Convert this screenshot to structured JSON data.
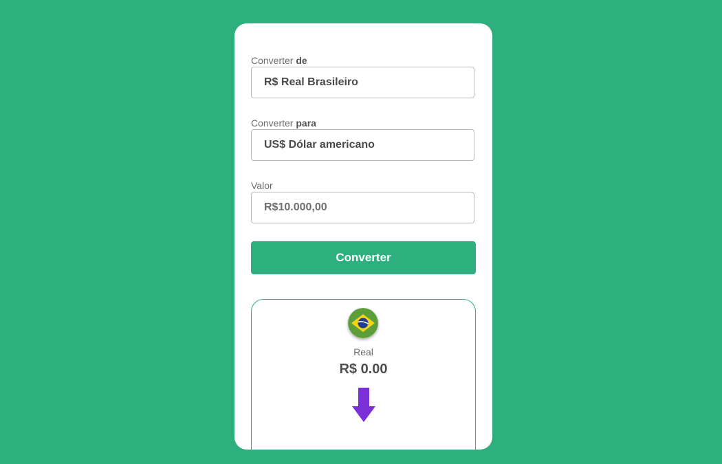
{
  "form": {
    "from_label_prefix": "Converter ",
    "from_label_bold": "de",
    "from_value": "R$ Real Brasileiro",
    "to_label_prefix": "Converter ",
    "to_label_bold": "para",
    "to_value": "US$ Dólar americano",
    "amount_label": "Valor",
    "amount_value": "R$10.000,00",
    "convert_button": "Converter"
  },
  "result": {
    "source_flag_icon": "brazil-flag-icon",
    "source_currency_name": "Real",
    "source_amount": "R$ 0.00",
    "arrow_icon": "arrow-down-icon",
    "arrow_color": "#7b2fd6"
  },
  "colors": {
    "background": "#2db07d",
    "accent": "#2db07d",
    "card": "#ffffff"
  }
}
